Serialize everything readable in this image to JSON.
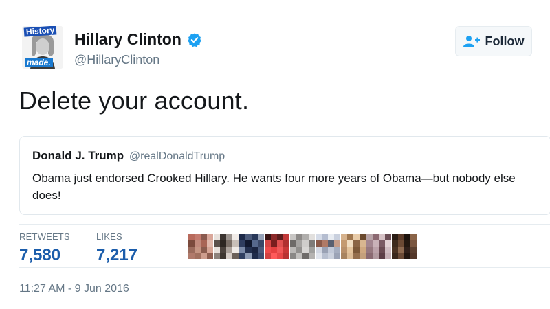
{
  "author": {
    "display_name": "Hillary Clinton",
    "handle": "@HillaryClinton",
    "verified": true,
    "avatar_caption_top": "History",
    "avatar_caption_bottom": "made."
  },
  "follow_button": {
    "label": "Follow",
    "icon": "add-user-icon"
  },
  "tweet": {
    "text": "Delete your account."
  },
  "quoted_tweet": {
    "display_name": "Donald J. Trump",
    "handle": "@realDonaldTrump",
    "text": "Obama just endorsed Crooked Hillary. He wants four more years of Obama—but nobody else does!"
  },
  "stats": {
    "retweets_label": "RETWEETS",
    "retweets_value": "7,580",
    "likes_label": "LIKES",
    "likes_value": "7,217"
  },
  "timestamp": "11:27 AM - 9 Jun 2016",
  "colors": {
    "link_blue": "#1b5dab",
    "verified_blue": "#1da1f2",
    "muted": "#657786"
  },
  "likers": [
    [
      "#b86a5c",
      "#c47b6f",
      "#8a5a4f",
      "#d9a79a",
      "#7a4a3c",
      "#c08a7c",
      "#a86555",
      "#e0b8ab",
      "#9b6b5c",
      "#c59583",
      "#8a5c4e",
      "#d6a595",
      "#b07a6b",
      "#a1705f",
      "#cd9d8d",
      "#8e5e50"
    ],
    [
      "#e8e2dd",
      "#3b3430",
      "#9c948f",
      "#f1ece8",
      "#5a504a",
      "#2d2621",
      "#7a6e66",
      "#c8bfb8",
      "#e6dfda",
      "#4b423c",
      "#aba19a",
      "#f0ebe7",
      "#8c827c",
      "#3d352f",
      "#d5ccc6",
      "#6b615a"
    ],
    [
      "#1d2a49",
      "#4b5a7a",
      "#283859",
      "#96a2b8",
      "#2e3d5f",
      "#10182e",
      "#56688c",
      "#3a4868",
      "#7a8aa8",
      "#222f4e",
      "#1a2440",
      "#4a5a7c",
      "#2f3f61",
      "#8d9bb4",
      "#1e2b4a",
      "#3d4d6f"
    ],
    [
      "#3a1414",
      "#8b2a2a",
      "#5c1e1e",
      "#c23a3a",
      "#d64545",
      "#7a1e1e",
      "#e05050",
      "#b03030",
      "#ef4b4b",
      "#e64040",
      "#f05858",
      "#c93838",
      "#d24242",
      "#ff5a5a",
      "#e84848",
      "#b83434"
    ],
    [
      "#c8c6c4",
      "#8d8a88",
      "#b0aeac",
      "#e2e0de",
      "#6d6a68",
      "#a5a3a1",
      "#cfcdcb",
      "#7e7b79",
      "#bbb9b7",
      "#918f8d",
      "#d8d6d4",
      "#a0a09e",
      "#8a8886",
      "#c2c0be",
      "#6f6c6a",
      "#b5b3b1"
    ],
    [
      "#d6dce8",
      "#b5bdd0",
      "#e8ecf2",
      "#c9d0de",
      "#8a5a4a",
      "#b07a66",
      "#5a6070",
      "#c69d8a",
      "#d2d7e2",
      "#9aa2b4",
      "#c2c9d8",
      "#a6aec0",
      "#e0e4ec",
      "#b8c0d0",
      "#ccd2de",
      "#9ba3b6"
    ],
    [
      "#d6b28c",
      "#a07850",
      "#e8cba8",
      "#6b4a2e",
      "#c49a70",
      "#f0dcc0",
      "#8a6444",
      "#d8b690",
      "#b8906a",
      "#e4c49c",
      "#7c5838",
      "#cfa880",
      "#a88460",
      "#dcbc96",
      "#946e4c",
      "#c4a07c"
    ],
    [
      "#b8a4a8",
      "#8c6a72",
      "#d6c2c6",
      "#6c4e56",
      "#a38690",
      "#c9b2b8",
      "#7a5a64",
      "#e2d0d4",
      "#96787f",
      "#bca2aa",
      "#6a4a52",
      "#d0bcc2",
      "#8a6a72",
      "#b29aa0",
      "#5c3e46",
      "#c6b0b6"
    ],
    [
      "#2a1c14",
      "#5a3a28",
      "#1c120c",
      "#8a6448",
      "#3e2a1c",
      "#6c4a34",
      "#241810",
      "#7a5640",
      "#4a3222",
      "#8e6a50",
      "#30201a",
      "#5c4030",
      "#3a281c",
      "#6a4a36",
      "#221610",
      "#54382a"
    ]
  ]
}
